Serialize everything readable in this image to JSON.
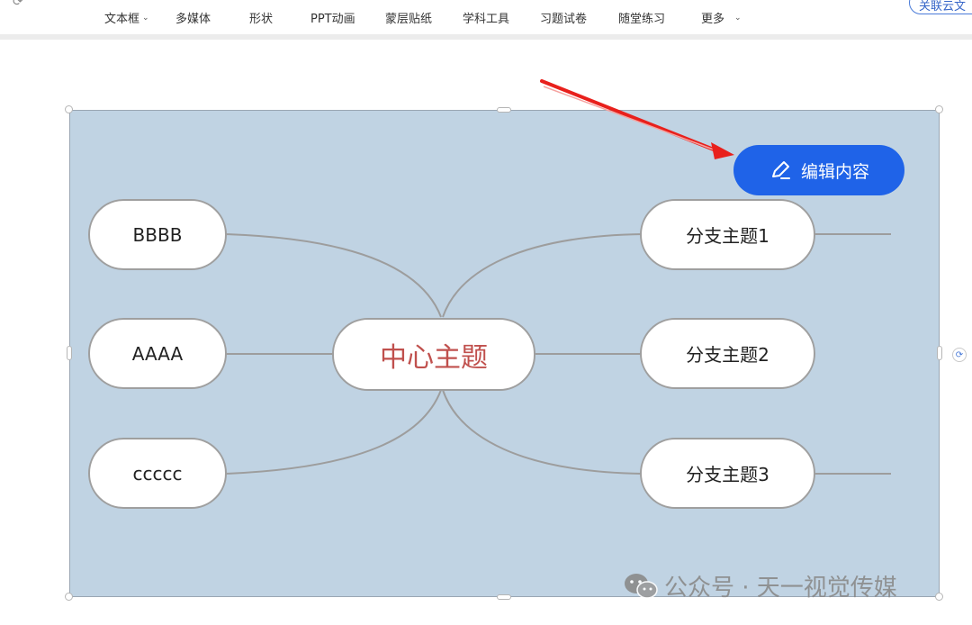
{
  "toolbar": {
    "items": [
      {
        "label": "文本框",
        "has_caret": true
      },
      {
        "label": "多媒体"
      },
      {
        "label": "形状"
      },
      {
        "label": "PPT动画"
      },
      {
        "label": "蒙层贴纸"
      },
      {
        "label": "学科工具"
      },
      {
        "label": "习题试卷"
      },
      {
        "label": "随堂练习"
      },
      {
        "label": "更多",
        "has_caret": true
      }
    ],
    "right_button": "关联云文"
  },
  "mindmap": {
    "center": "中心主题",
    "left_nodes": [
      "BBBB",
      "AAAA",
      "ccccc"
    ],
    "right_nodes": [
      "分支主题1",
      "分支主题2",
      "分支主题3"
    ],
    "background_color": "#c0d3e3",
    "center_text_color": "#c0504d"
  },
  "edit_button": {
    "label": "编辑内容",
    "icon": "pencil-icon",
    "color": "#1f63e8"
  },
  "watermark": {
    "text": "公众号 · 天一视觉传媒",
    "icon": "wechat-icon"
  },
  "arrow_color": "#e8201c"
}
